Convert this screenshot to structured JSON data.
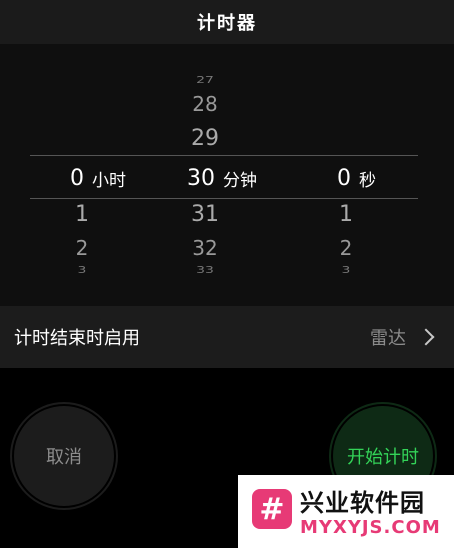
{
  "header": {
    "title": "计时器"
  },
  "picker": {
    "hours": {
      "above": [
        "",
        "",
        ""
      ],
      "selected": "0",
      "unit": "小时",
      "below": [
        "1",
        "2",
        "3"
      ]
    },
    "minutes": {
      "above": [
        "27",
        "28",
        "29"
      ],
      "selected": "30",
      "unit": "分钟",
      "below": [
        "31",
        "32",
        "33"
      ]
    },
    "seconds": {
      "above": [
        "",
        "",
        ""
      ],
      "selected": "0",
      "unit": "秒",
      "below": [
        "1",
        "2",
        "3"
      ]
    }
  },
  "setting_row": {
    "label": "计时结束时启用",
    "value": "雷达",
    "chevron_icon": "chevron-right-icon"
  },
  "buttons": {
    "cancel_label": "取消",
    "start_label": "开始计时"
  },
  "colors": {
    "accent_green": "#33d358",
    "watermark_pink": "#e73a76"
  },
  "watermark": {
    "logo_glyph": "#",
    "title": "兴业软件园",
    "subtitle": "MYXYJS.COM"
  }
}
